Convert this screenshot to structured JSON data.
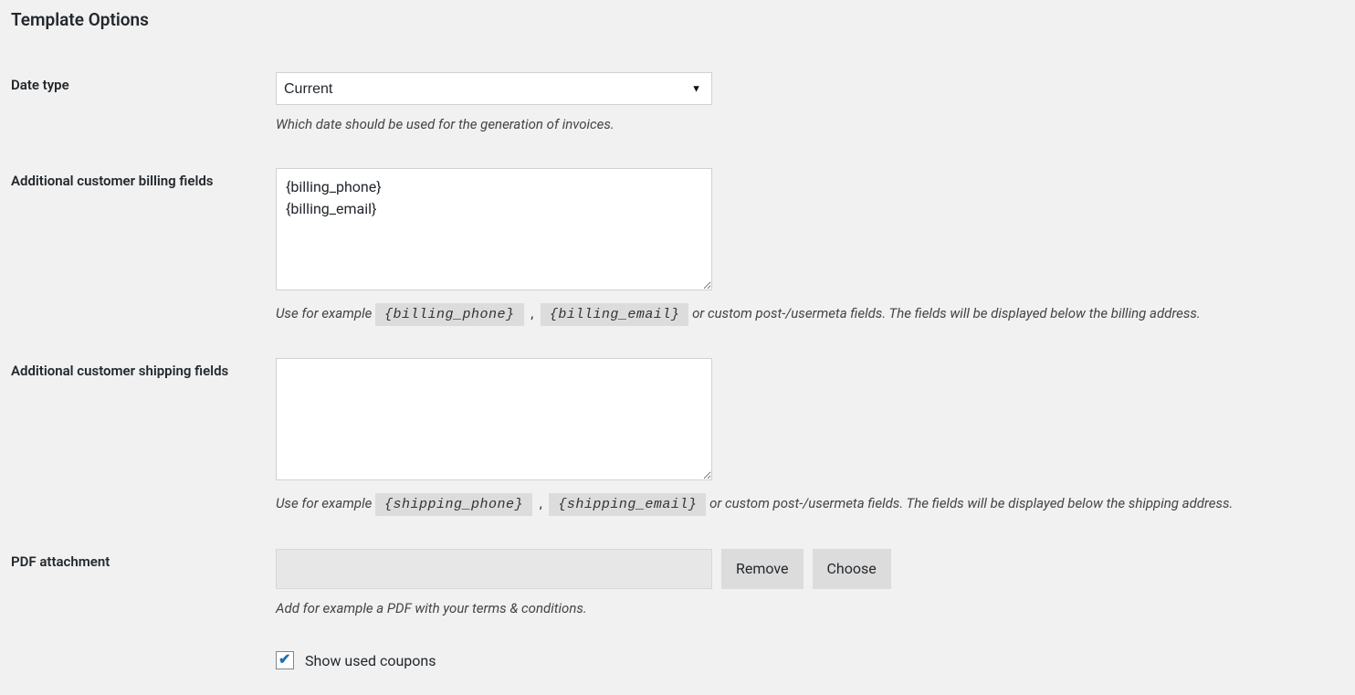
{
  "section_title": "Template Options",
  "date_type": {
    "label": "Date type",
    "selected": "Current",
    "description": "Which date should be used for the generation of invoices."
  },
  "billing_fields": {
    "label": "Additional customer billing fields",
    "value": "{billing_phone}\n{billing_email}",
    "desc_prefix": "Use for example ",
    "token1": "{billing_phone}",
    "token2": "{billing_email}",
    "desc_suffix": " or custom post-/usermeta fields. The fields will be displayed below the billing address."
  },
  "shipping_fields": {
    "label": "Additional customer shipping fields",
    "value": "",
    "desc_prefix": "Use for example ",
    "token1": "{shipping_phone}",
    "token2": "{shipping_email}",
    "desc_suffix": " or custom post-/usermeta fields. The fields will be displayed below the shipping address."
  },
  "pdf_attachment": {
    "label": "PDF attachment",
    "value": "",
    "remove_label": "Remove",
    "choose_label": "Choose",
    "description": "Add for example a PDF with your terms & conditions."
  },
  "show_coupons": {
    "label": "Show used coupons",
    "checked": true
  }
}
